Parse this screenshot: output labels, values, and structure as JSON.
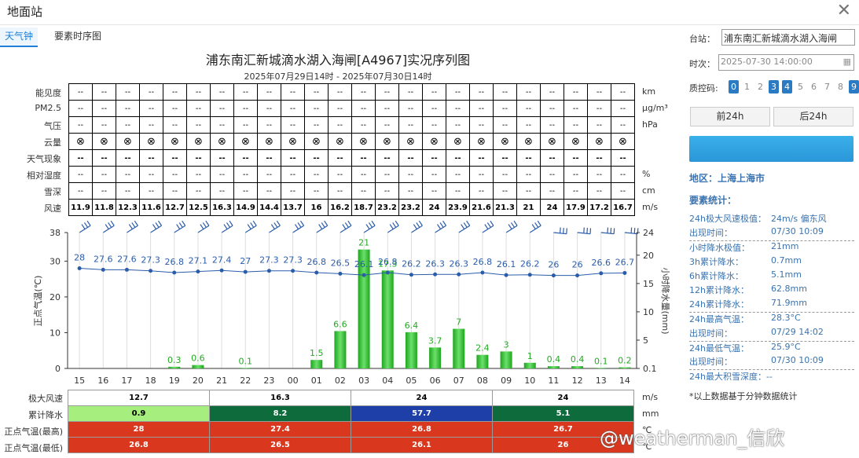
{
  "window": {
    "title": "地面站"
  },
  "tabs": [
    {
      "label": "天气钟"
    },
    {
      "label": "要素时序图"
    }
  ],
  "chart": {
    "title": "浦东南汇新城滴水湖入海闸[A4967]实况序列图",
    "subtitle": "2025年07月29日14时 - 2025年07月30日14时"
  },
  "table": {
    "rows": [
      {
        "label": "能见度",
        "unit": "km",
        "cells": [
          "--",
          "--",
          "--",
          "--",
          "--",
          "--",
          "--",
          "--",
          "--",
          "--",
          "--",
          "--",
          "--",
          "--",
          "--",
          "--",
          "--",
          "--",
          "--",
          "--",
          "--",
          "--",
          "--",
          "--",
          "--"
        ],
        "bold": false
      },
      {
        "label": "PM2.5",
        "unit": "μg/m³",
        "cells": [
          "--",
          "--",
          "--",
          "--",
          "--",
          "--",
          "--",
          "--",
          "--",
          "--",
          "--",
          "--",
          "--",
          "--",
          "--",
          "--",
          "--",
          "--",
          "--",
          "--",
          "--",
          "--",
          "--",
          "--",
          "--"
        ],
        "bold": false
      },
      {
        "label": "气压",
        "unit": "hPa",
        "cells": [
          "--",
          "--",
          "--",
          "--",
          "--",
          "--",
          "--",
          "--",
          "--",
          "--",
          "--",
          "--",
          "--",
          "--",
          "--",
          "--",
          "--",
          "--",
          "--",
          "--",
          "--",
          "--",
          "--",
          "--",
          "--"
        ],
        "bold": false
      },
      {
        "label": "云量",
        "unit": "",
        "cells": [
          "⊗",
          "⊗",
          "⊗",
          "⊗",
          "⊗",
          "⊗",
          "⊗",
          "⊗",
          "⊗",
          "⊗",
          "⊗",
          "⊗",
          "⊗",
          "⊗",
          "⊗",
          "⊗",
          "⊗",
          "⊗",
          "⊗",
          "⊗",
          "⊗",
          "⊗",
          "⊗",
          "⊗",
          "⊗"
        ],
        "bold": false
      },
      {
        "label": "天气现象",
        "unit": "",
        "cells": [
          "--",
          "--",
          "--",
          "--",
          "--",
          "--",
          "--",
          "--",
          "--",
          "--",
          "--",
          "--",
          "--",
          "--",
          "--",
          "--",
          "--",
          "--",
          "--",
          "--",
          "--",
          "--",
          "--",
          "--",
          "--"
        ],
        "bold": true
      },
      {
        "label": "相对湿度",
        "unit": "%",
        "cells": [
          "--",
          "--",
          "--",
          "--",
          "--",
          "--",
          "--",
          "--",
          "--",
          "--",
          "--",
          "--",
          "--",
          "--",
          "--",
          "--",
          "--",
          "--",
          "--",
          "--",
          "--",
          "--",
          "--",
          "--",
          "--"
        ],
        "bold": false
      },
      {
        "label": "雪深",
        "unit": "cm",
        "cells": [
          "--",
          "--",
          "--",
          "--",
          "--",
          "--",
          "--",
          "--",
          "--",
          "--",
          "--",
          "--",
          "--",
          "--",
          "--",
          "--",
          "--",
          "--",
          "--",
          "--",
          "--",
          "--",
          "--",
          "--",
          "--"
        ],
        "bold": false
      },
      {
        "label": "风速",
        "unit": "m/s",
        "cells": [
          "11.9",
          "11.8",
          "12.3",
          "11.6",
          "12.7",
          "12.5",
          "16.3",
          "14.9",
          "14.4",
          "13.7",
          "16",
          "16.2",
          "18.7",
          "23.2",
          "23.2",
          "24",
          "23.9",
          "21.6",
          "21.3",
          "21",
          "24",
          "17.9",
          "17.2",
          "16.7",
          ""
        ],
        "bold": true
      }
    ]
  },
  "chart_data": {
    "type": "bar",
    "categories": [
      "15",
      "16",
      "17",
      "18",
      "19",
      "20",
      "21",
      "22",
      "23",
      "00",
      "01",
      "02",
      "03",
      "04",
      "05",
      "06",
      "07",
      "08",
      "09",
      "10",
      "11",
      "12",
      "13",
      "14"
    ],
    "series": [
      {
        "values": [
          28,
          27.6,
          27.6,
          27.3,
          26.8,
          27.1,
          27.4,
          27,
          27.3,
          27.3,
          26.8,
          26.5,
          26.1,
          26.8,
          26.2,
          26.3,
          26.3,
          26.8,
          26.1,
          26.2,
          26,
          26,
          26.6,
          26.7
        ]
      },
      {
        "values": [
          0,
          0,
          0,
          0,
          0.3,
          0.6,
          0,
          0.1,
          0,
          0,
          1.5,
          6.6,
          21,
          17.3,
          6.4,
          3.7,
          7,
          2.4,
          3,
          1,
          0.4,
          0.4,
          0.1,
          0.2
        ]
      }
    ],
    "ylabel": "正点气温(℃)",
    "y2label": "小时降水量(mm)",
    "y_ticks": [
      "0",
      "10",
      "20",
      "30",
      "38"
    ],
    "y2_ticks": [
      "0.1",
      "5",
      "10",
      "15",
      "20",
      "24"
    ],
    "ylim": [
      0,
      38
    ],
    "y2lim": [
      0,
      24
    ],
    "colors": {
      "temp": "#2a5caa",
      "rain": "#22bb22"
    }
  },
  "bottom": {
    "rows": [
      {
        "label": "极大风速",
        "unit": "m/s",
        "cells": [
          "12.7",
          "16.3",
          "24",
          "24"
        ],
        "colors": [
          "#ffffff",
          "#ffffff",
          "#ffffff",
          "#ffffff"
        ]
      },
      {
        "label": "累计降水",
        "unit": "mm",
        "cells": [
          "0.9",
          "8.2",
          "57.7",
          "5.1"
        ],
        "colors": [
          "#a6ef7e",
          "#0e6b3c",
          "#1e3fa8",
          "#0e6b3c"
        ]
      },
      {
        "label": "正点气温(最高)",
        "unit": "℃",
        "cells": [
          "28",
          "27.4",
          "26.8",
          "26.7"
        ],
        "colors": [
          "#d9381e",
          "#d9381e",
          "#d9381e",
          "#d9381e"
        ]
      },
      {
        "label": "正点气温(最低)",
        "unit": "℃",
        "cells": [
          "26.8",
          "26.5",
          "26.1",
          "26"
        ],
        "colors": [
          "#d9381e",
          "#d9381e",
          "#d9381e",
          "#d9381e"
        ]
      }
    ]
  },
  "side": {
    "station_label": "台站：",
    "station_value": "浦东南汇新城滴水湖入海闸",
    "time_label": "时次：",
    "time_value": "2025-07-30 14:00:00",
    "qc_label": "质控码:",
    "qc": [
      {
        "d": "0",
        "on": true
      },
      {
        "d": "1",
        "on": false
      },
      {
        "d": "2",
        "on": false
      },
      {
        "d": "3",
        "on": true
      },
      {
        "d": "4",
        "on": true
      },
      {
        "d": "5",
        "on": false
      },
      {
        "d": "6",
        "on": false
      },
      {
        "d": "7",
        "on": false
      },
      {
        "d": "8",
        "on": false
      },
      {
        "d": "9",
        "on": true
      }
    ],
    "prev": "前24h",
    "next": "后24h",
    "region": "地区：上海上海市",
    "stats_head": "要素统计：",
    "stats": [
      {
        "k": "24h极大风速极值：",
        "v": "24m/s 偏东风",
        "sep": false
      },
      {
        "k": "出现时间：",
        "v": "07/30 10:09",
        "sep": false
      },
      {
        "k": "小时降水极值：",
        "v": "21mm",
        "sep": true
      },
      {
        "k": "3h累计降水：",
        "v": "0.7mm",
        "sep": false
      },
      {
        "k": "6h累计降水：",
        "v": "5.1mm",
        "sep": false
      },
      {
        "k": "12h累计降水：",
        "v": "62.8mm",
        "sep": false
      },
      {
        "k": "24h累计降水：",
        "v": "71.9mm",
        "sep": false
      },
      {
        "k": "24h最高气温：",
        "v": "28.3°C",
        "sep": true
      },
      {
        "k": "出现时间：",
        "v": "07/29 14:02",
        "sep": false
      },
      {
        "k": "24h最低气温：",
        "v": "25.9°C",
        "sep": true
      },
      {
        "k": "出现时间：",
        "v": "07/30 10:09",
        "sep": false
      },
      {
        "k": "24h最大积雪深度：--",
        "v": "",
        "sep": true
      }
    ],
    "note": "*以上数据基于分钟数据统计"
  },
  "watermark": "@weatherman_信欣"
}
